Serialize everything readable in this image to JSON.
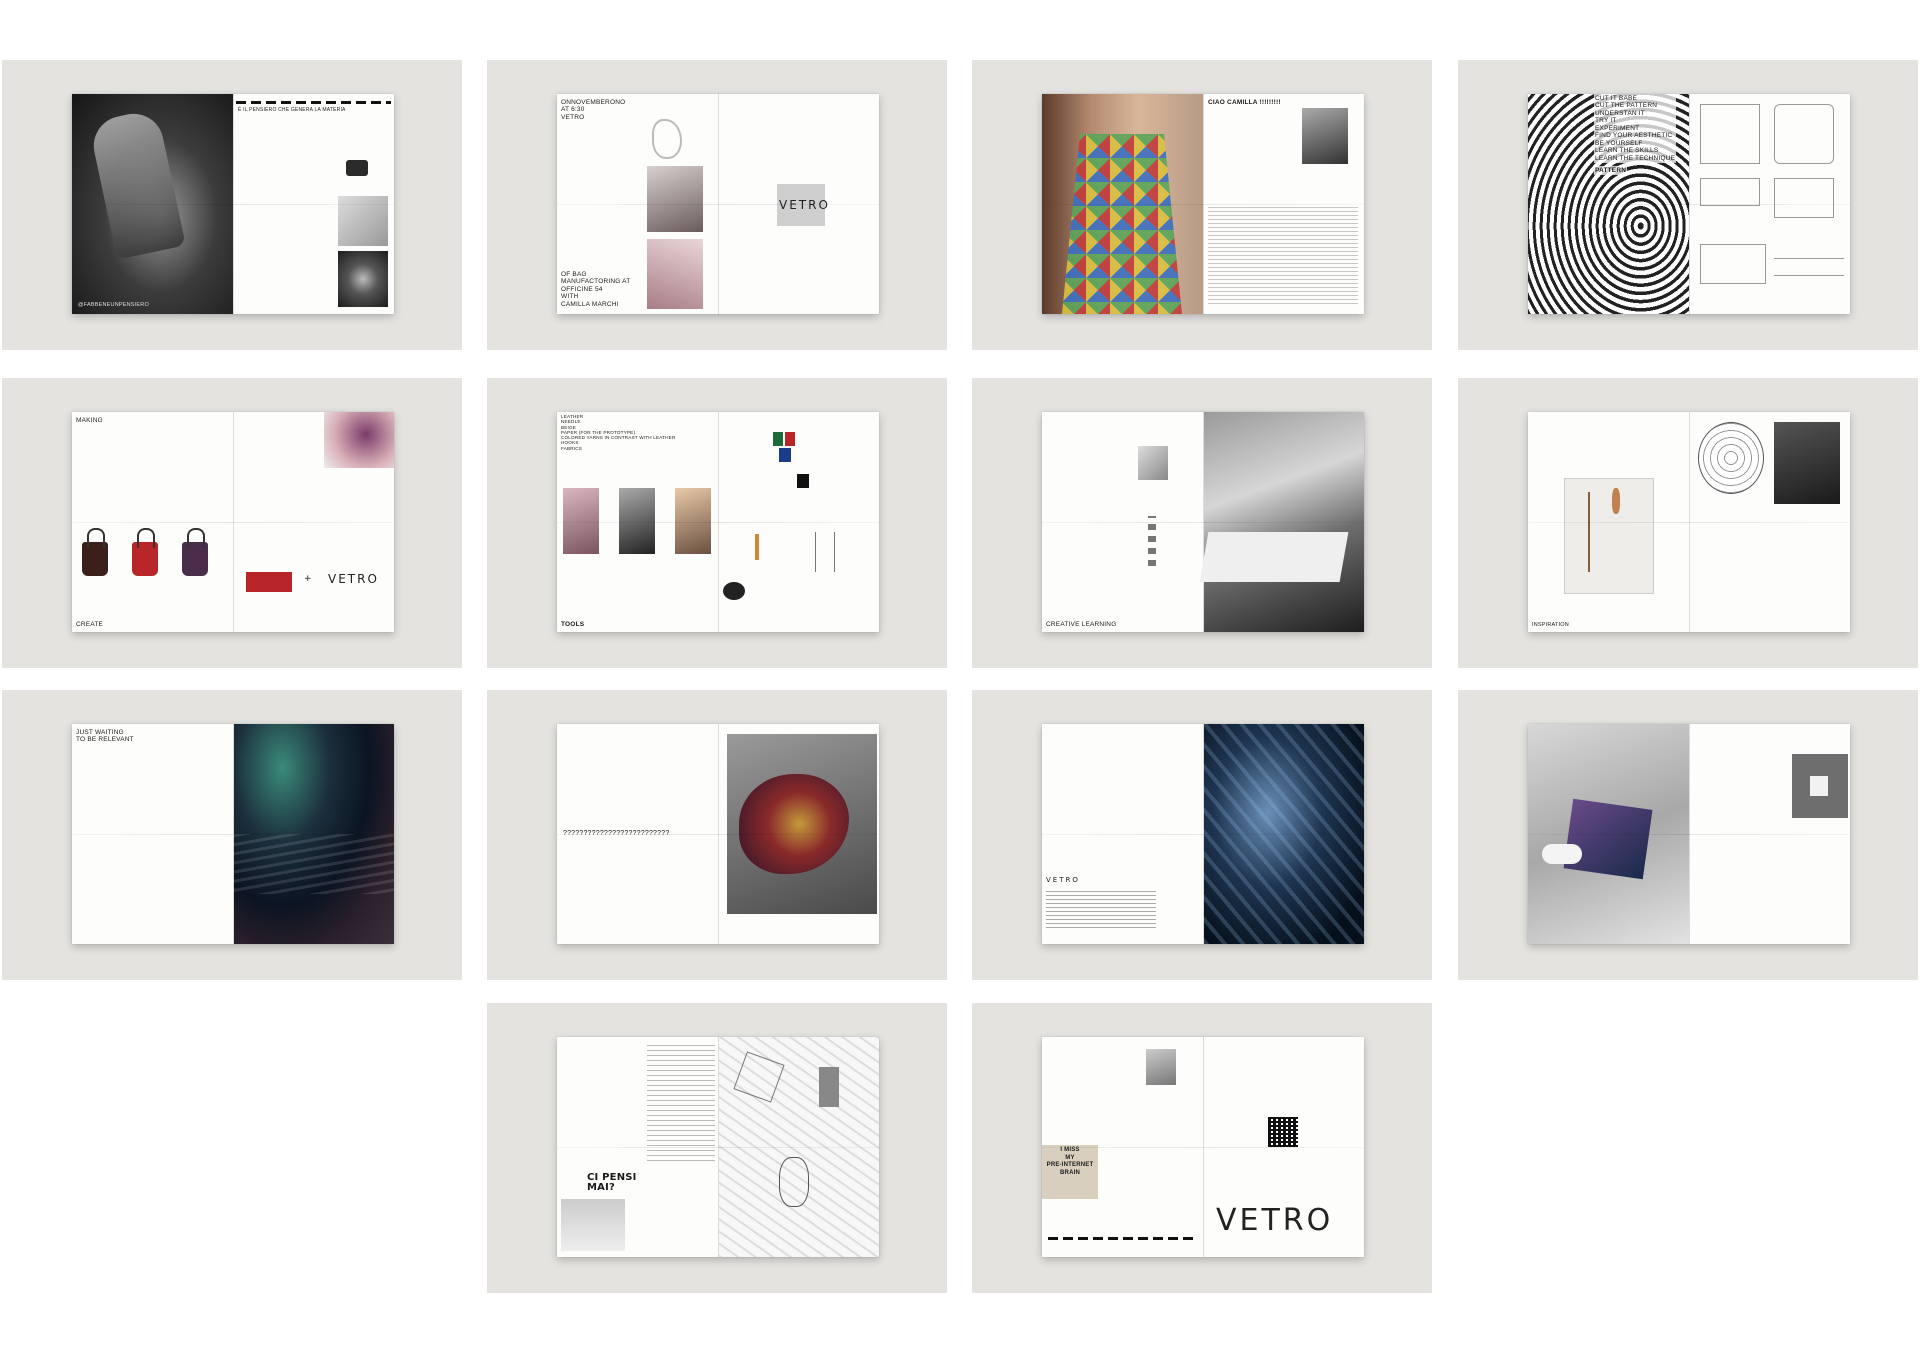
{
  "colors": {
    "tile_background": "#e4e3df",
    "page": "#fdfdfc",
    "accent_red": "#b8262a"
  },
  "spreads": {
    "s1": {
      "heading": "È IL PENSIERO CHE GENERA LA MATERIA",
      "caption": "@FABBENEUNPENSIERO"
    },
    "s2": {
      "top_text": "ONNOVEMBERONO\nAT 6:30\nVETRO",
      "bottom_text": "OF BAG\nMANUFACTORING AT\nOFFICINE 54\nWITH\nCAMILLA MARCHI",
      "brand": "VETRO"
    },
    "s3": {
      "heading": "CIAO CAMILLA !!!!!!!!!"
    },
    "s4": {
      "heading": "CUT IT BABE\nCUT THE PATTERN\nUNDERSTAN IT\nTRY IT\nEXPERIMENT\nFIND YOUR AESTHETIC\nBE YOURSELF\nLEARN THE SKILLS\nLEARN THE TECHNIQUE",
      "label": "PATTERN"
    },
    "s5": {
      "top": "MAKING",
      "bottom": "CREATE",
      "brand": "VETRO",
      "plus": "+"
    },
    "s6": {
      "list": "LEATHER\nNEEDLE\nBEIGE\nPAPER (FOR THE PROTOTYPE)\nCOLORED YARNS IN CONTRAST WITH LEATHER\nHOOKS\nFABRICS",
      "label": "TOOLS"
    },
    "s7": {
      "label": "CREATIVE LEARNING"
    },
    "s8": {
      "label": "INSPIRATION"
    },
    "s9": {
      "heading": "JUST WAITING\nTO BE RELEVANT"
    },
    "s10": {
      "question": "??????????????????????????"
    },
    "s11": {
      "brand": "VETRO"
    },
    "s13": {
      "sticker": "CI PENSI\nMAI?"
    },
    "s14": {
      "sticker": "I MISS\nMY\nPRE-INTERNET\nBRAIN",
      "brand": "VETRO"
    }
  }
}
